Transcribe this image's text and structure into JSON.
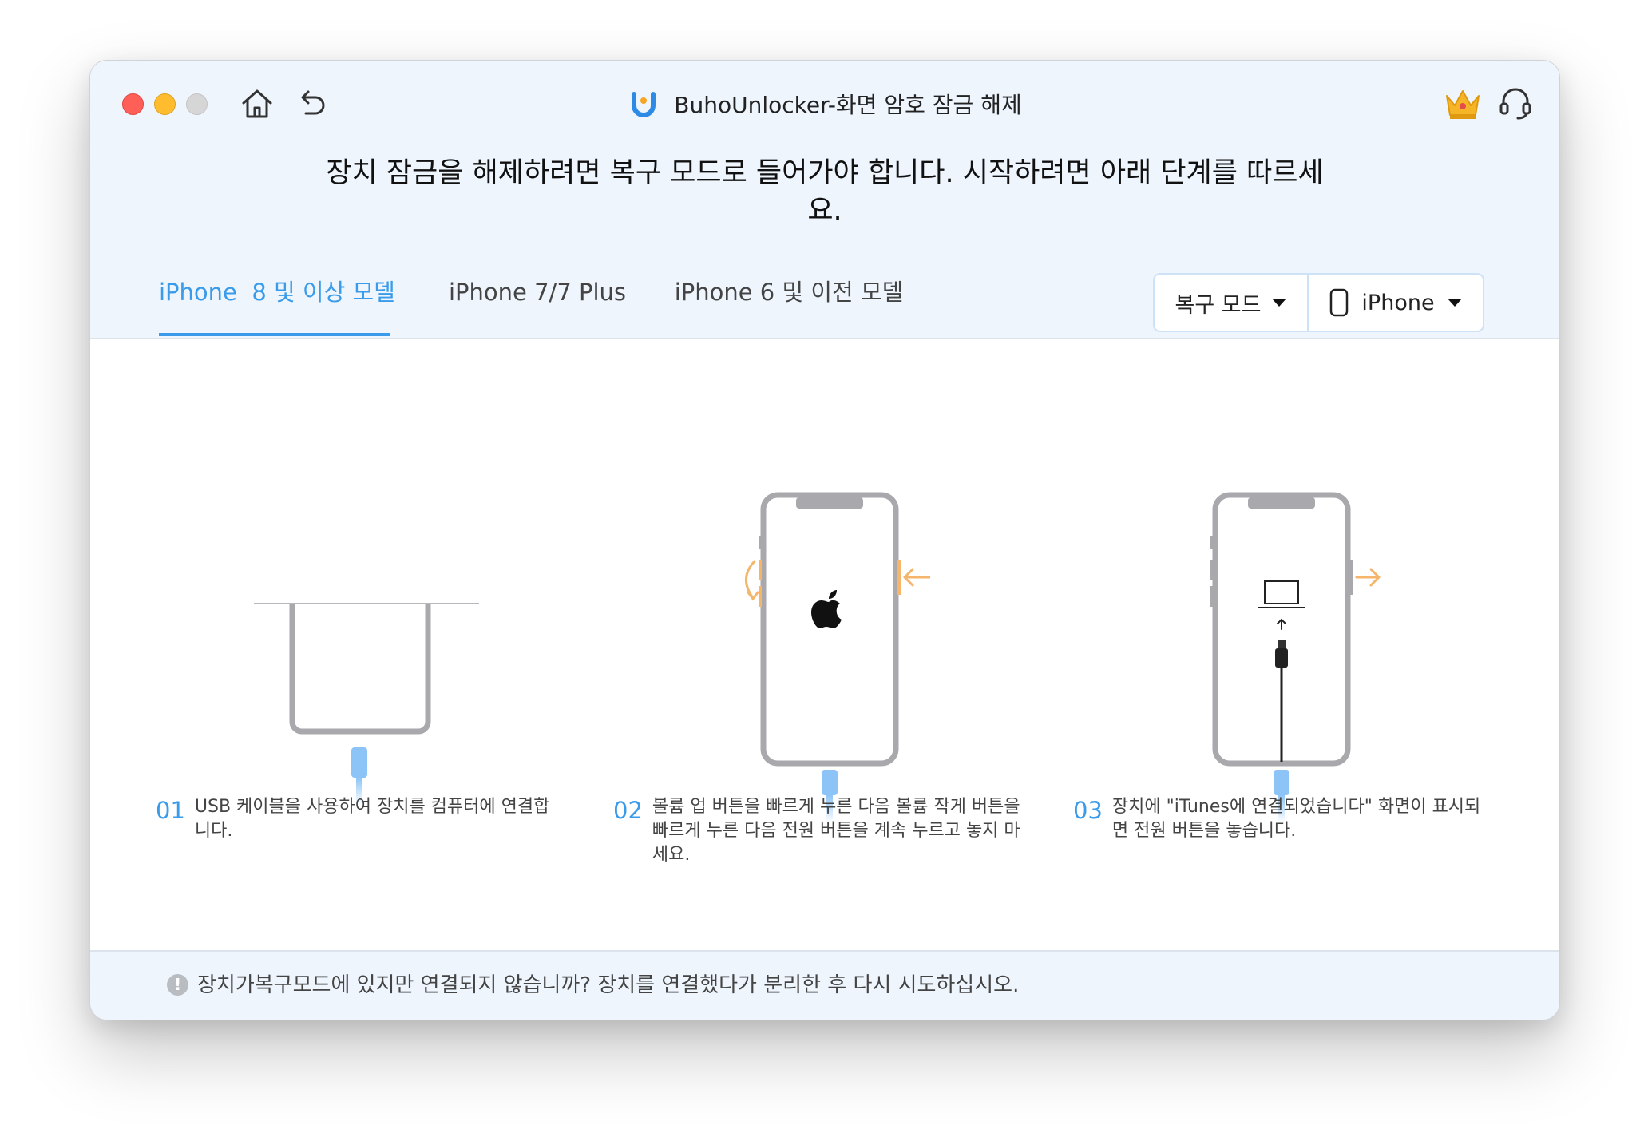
{
  "window": {
    "app_title": "BuhoUnlocker-화면 암호 잠금 해제"
  },
  "header": {
    "headline_line1": "장치 잠금을 해제하려면 복구 모드로 들어가야 합니다. 시작하려면 아래 단계를 따르세",
    "headline_line2": "요."
  },
  "tabs": [
    {
      "label": "iPhone  8 및 이상 모델",
      "active": true
    },
    {
      "label": "iPhone 7/7 Plus",
      "active": false
    },
    {
      "label": "iPhone 6 및 이전 모델",
      "active": false
    }
  ],
  "selector": {
    "mode_label": "복구 모드",
    "device_label": "iPhone"
  },
  "steps": [
    {
      "num": "01",
      "text": "USB 케이블을 사용하여 장치를 컴퓨터에 연결합니다."
    },
    {
      "num": "02",
      "text": "볼륨 업 버튼을 빠르게 누른 다음 볼륨 작게 버튼을 빠르게 누른 다음 전원 버튼을 계속 누르고 놓지 마세요."
    },
    {
      "num": "03",
      "text": "장치에 \"iTunes에 연결되었습니다\" 화면이 표시되면 전원 버튼을 놓습니다."
    }
  ],
  "footer": {
    "notice": "장치가복구모드에 있지만 연결되지 않습니까? 장치를 연결했다가 분리한 후 다시 시도하십시오."
  },
  "icons": {
    "logo": "buho-logo-icon",
    "home": "home-icon",
    "back": "back-arrow-icon",
    "crown": "crown-icon",
    "support": "headset-icon",
    "phone": "phone-icon",
    "info": "info-icon"
  },
  "colors": {
    "accent": "#3a9bea",
    "arrow": "#f5b56b",
    "cable": "#8cc4f7",
    "phone_frame": "#a8a8ad",
    "band": "#eef5fd"
  }
}
